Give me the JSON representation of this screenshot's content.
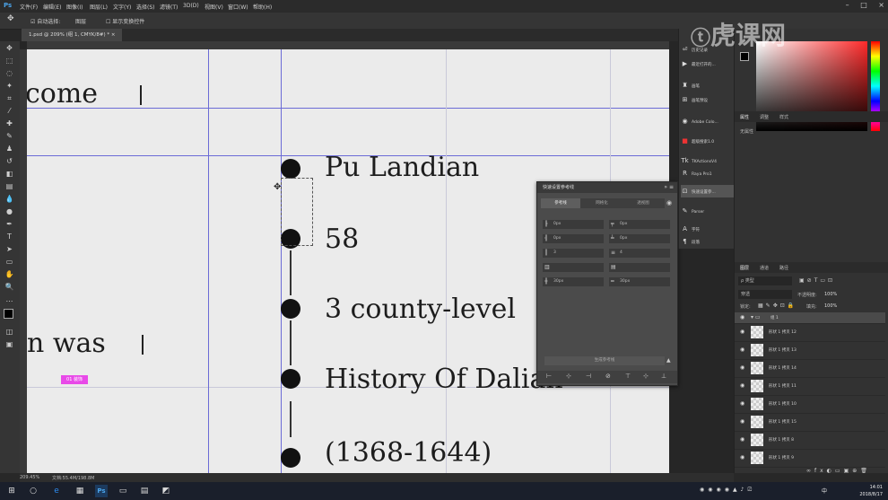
{
  "app": {
    "logo": "Ps"
  },
  "menu": [
    "文件(F)",
    "编辑(E)",
    "图像(I)",
    "图层(L)",
    "文字(Y)",
    "选择(S)",
    "滤镜(T)",
    "3D(D)",
    "视图(V)",
    "窗口(W)",
    "帮助(H)"
  ],
  "options": {
    "auto_select": "自动选择:",
    "target": "图层",
    "show_transform": "显示变换控件"
  },
  "document_tab": "1.psd @ 209% (组 1, CMYK/8#) *",
  "canvas": {
    "left_words": [
      "come",
      "n was"
    ],
    "items": [
      "Pu Landian",
      "58",
      "3 county-level",
      "History Of Dalian",
      "(1368-1644)"
    ],
    "pink_label": "01 装饰"
  },
  "status": {
    "zoom": "209.45%",
    "doc": "文档:55.4M/198.8M"
  },
  "quick_panel": {
    "title": "快速设置参考线",
    "tabs": [
      "参考线",
      "网格化",
      "透视图"
    ],
    "fields": [
      "0px",
      "0px",
      "0px",
      "0px",
      "3",
      "4",
      "",
      "",
      "30px",
      "30px"
    ],
    "apply_button": "生成参考线",
    "footer_icons": [
      "align-left-icon",
      "align-hcenter-icon",
      "align-right-icon",
      "delete-icon",
      "align-top-icon",
      "align-vcenter-icon",
      "align-bottom-icon"
    ]
  },
  "side_panels": [
    {
      "icon": "⏎",
      "label": "历史记录"
    },
    {
      "icon": "▶",
      "label": "最近打开的..."
    },
    {
      "icon": "♜",
      "label": "画笔"
    },
    {
      "icon": "⊞",
      "label": "画笔预设"
    },
    {
      "icon": "◉",
      "label": "Adobe Colo..."
    },
    {
      "icon": "■",
      "label": "超级搜索1.0"
    },
    {
      "icon": "Tk",
      "label": "TKActionsV4"
    },
    {
      "icon": "R",
      "label": "Raya Pro1"
    },
    {
      "icon": "⊡",
      "label": "快速设置参..."
    },
    {
      "icon": "✎",
      "label": "Parser"
    },
    {
      "icon": "A",
      "label": "字符"
    },
    {
      "icon": "¶",
      "label": "段落"
    }
  ],
  "properties": {
    "tabs": [
      "属性",
      "调整",
      "样式"
    ],
    "empty": "无属性"
  },
  "layers": {
    "tabs": [
      "图层",
      "通道",
      "路径"
    ],
    "filter": "ρ 类型",
    "blend": "穿透",
    "opacity_label": "不透明度:",
    "opacity": "100%",
    "lock_label": "锁定:",
    "fill_label": "填充:",
    "fill": "100%",
    "group": "组 1",
    "rows": [
      "形状 1 拷贝 12",
      "形状 1 拷贝 13",
      "形状 1 拷贝 14",
      "形状 1 拷贝 11",
      "形状 1 拷贝 10",
      "形状 1 拷贝 15",
      "形状 1 拷贝 8",
      "形状 1 拷贝 9"
    ]
  },
  "taskbar": {
    "time": "14:01",
    "date": "2018/8/17",
    "ime": "中"
  },
  "watermark": "虎课网",
  "colors": {
    "accent": "#4aa3e8",
    "guide": "#6b6bd6",
    "pink": "#e84ae8"
  }
}
